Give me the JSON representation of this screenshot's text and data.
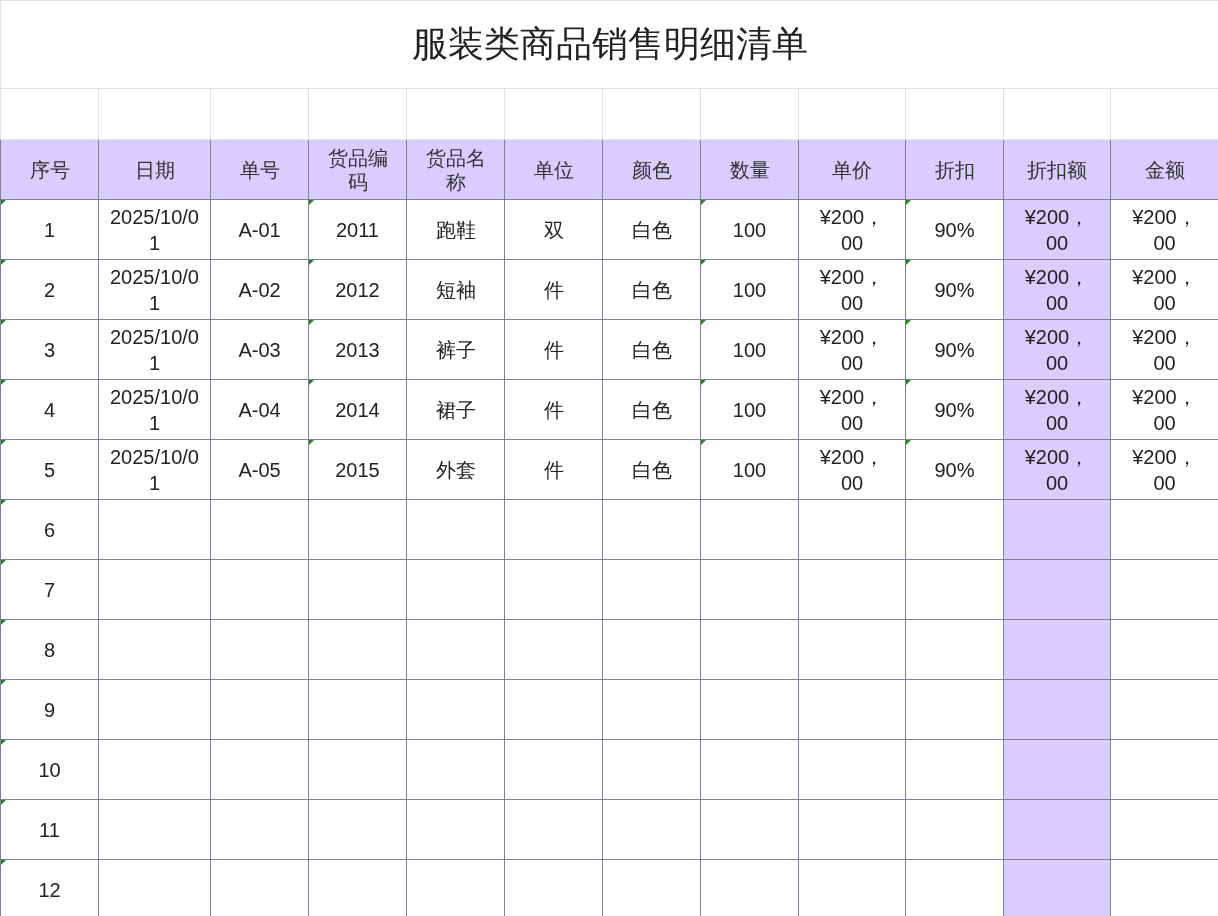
{
  "title": "服装类商品销售明细清单",
  "columns": [
    {
      "label": "序号",
      "highlighted": false
    },
    {
      "label": "日期",
      "highlighted": false
    },
    {
      "label": "单号",
      "highlighted": false
    },
    {
      "label": "货品编码",
      "highlighted": false
    },
    {
      "label": "货品名称",
      "highlighted": false
    },
    {
      "label": "单位",
      "highlighted": false
    },
    {
      "label": "颜色",
      "highlighted": false
    },
    {
      "label": "数量",
      "highlighted": false
    },
    {
      "label": "单价",
      "highlighted": false
    },
    {
      "label": "折扣",
      "highlighted": false
    },
    {
      "label": "折扣额",
      "highlighted": true
    },
    {
      "label": "金额",
      "highlighted": false
    }
  ],
  "rows": [
    {
      "cells": [
        {
          "text": "1",
          "flag": true
        },
        {
          "text": "2025/10/01",
          "flag": false
        },
        {
          "text": "A-01",
          "flag": false
        },
        {
          "text": "2011",
          "flag": true
        },
        {
          "text": "跑鞋",
          "flag": false
        },
        {
          "text": "双",
          "flag": false
        },
        {
          "text": "白色",
          "flag": false
        },
        {
          "text": "100",
          "flag": true
        },
        {
          "text": "¥200，00",
          "flag": false
        },
        {
          "text": "90%",
          "flag": true
        },
        {
          "text": "¥200，00",
          "flag": false
        },
        {
          "text": "¥200，00",
          "flag": false
        }
      ]
    },
    {
      "cells": [
        {
          "text": "2",
          "flag": true
        },
        {
          "text": "2025/10/01",
          "flag": false
        },
        {
          "text": "A-02",
          "flag": false
        },
        {
          "text": "2012",
          "flag": true
        },
        {
          "text": "短袖",
          "flag": false
        },
        {
          "text": "件",
          "flag": false
        },
        {
          "text": "白色",
          "flag": false
        },
        {
          "text": "100",
          "flag": true
        },
        {
          "text": "¥200，00",
          "flag": false
        },
        {
          "text": "90%",
          "flag": true
        },
        {
          "text": "¥200，00",
          "flag": false
        },
        {
          "text": "¥200，00",
          "flag": false
        }
      ]
    },
    {
      "cells": [
        {
          "text": "3",
          "flag": true
        },
        {
          "text": "2025/10/01",
          "flag": false
        },
        {
          "text": "A-03",
          "flag": false
        },
        {
          "text": "2013",
          "flag": true
        },
        {
          "text": "裤子",
          "flag": false
        },
        {
          "text": "件",
          "flag": false
        },
        {
          "text": "白色",
          "flag": false
        },
        {
          "text": "100",
          "flag": true
        },
        {
          "text": "¥200，00",
          "flag": false
        },
        {
          "text": "90%",
          "flag": true
        },
        {
          "text": "¥200，00",
          "flag": false
        },
        {
          "text": "¥200，00",
          "flag": false
        }
      ]
    },
    {
      "cells": [
        {
          "text": "4",
          "flag": true
        },
        {
          "text": "2025/10/01",
          "flag": false
        },
        {
          "text": "A-04",
          "flag": false
        },
        {
          "text": "2014",
          "flag": true
        },
        {
          "text": "裙子",
          "flag": false
        },
        {
          "text": "件",
          "flag": false
        },
        {
          "text": "白色",
          "flag": false
        },
        {
          "text": "100",
          "flag": true
        },
        {
          "text": "¥200，00",
          "flag": false
        },
        {
          "text": "90%",
          "flag": true
        },
        {
          "text": "¥200，00",
          "flag": false
        },
        {
          "text": "¥200，00",
          "flag": false
        }
      ]
    },
    {
      "cells": [
        {
          "text": "5",
          "flag": true
        },
        {
          "text": "2025/10/01",
          "flag": false
        },
        {
          "text": "A-05",
          "flag": false
        },
        {
          "text": "2015",
          "flag": true
        },
        {
          "text": "外套",
          "flag": false
        },
        {
          "text": "件",
          "flag": false
        },
        {
          "text": "白色",
          "flag": false
        },
        {
          "text": "100",
          "flag": true
        },
        {
          "text": "¥200，00",
          "flag": false
        },
        {
          "text": "90%",
          "flag": true
        },
        {
          "text": "¥200，00",
          "flag": false
        },
        {
          "text": "¥200，00",
          "flag": false
        }
      ]
    },
    {
      "cells": [
        {
          "text": "6",
          "flag": true
        }
      ]
    },
    {
      "cells": [
        {
          "text": "7",
          "flag": true
        }
      ]
    },
    {
      "cells": [
        {
          "text": "8",
          "flag": true
        }
      ]
    },
    {
      "cells": [
        {
          "text": "9",
          "flag": true
        }
      ]
    },
    {
      "cells": [
        {
          "text": "10",
          "flag": true
        }
      ]
    },
    {
      "cells": [
        {
          "text": "11",
          "flag": true
        }
      ]
    },
    {
      "cells": [
        {
          "text": "12",
          "flag": true
        }
      ]
    }
  ]
}
